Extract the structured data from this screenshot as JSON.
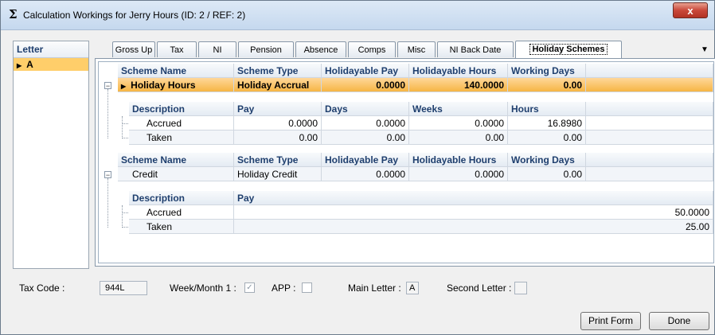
{
  "window": {
    "title": "Calculation Workings for Jerry Hours (ID: 2  /  REF: 2)",
    "title_icon": "Σ",
    "close_glyph": "x"
  },
  "letters": {
    "header": "Letter",
    "rows": [
      {
        "label": "A"
      }
    ]
  },
  "tabs": [
    {
      "label": "Gross Up"
    },
    {
      "label": "Tax"
    },
    {
      "label": "NI"
    },
    {
      "label": "Pension"
    },
    {
      "label": "Absence"
    },
    {
      "label": "Comps"
    },
    {
      "label": "Misc"
    },
    {
      "label": "NI Back Date"
    },
    {
      "label": "Holiday Schemes",
      "active": true
    }
  ],
  "scheme_headers": {
    "name": "Scheme Name",
    "type": "Scheme Type",
    "pay": "Holidayable Pay",
    "hours": "Holidayable Hours",
    "days": "Working Days"
  },
  "schemes": [
    {
      "name": "Holiday Hours",
      "type": "Holiday Accrual",
      "pay": "0.0000",
      "hours": "140.0000",
      "days": "0.00",
      "detail_headers": {
        "description": "Description",
        "pay": "Pay",
        "days": "Days",
        "weeks": "Weeks",
        "hours": "Hours"
      },
      "details": [
        {
          "description": "Accrued",
          "pay": "0.0000",
          "days": "0.0000",
          "weeks": "0.0000",
          "hours": "16.8980"
        },
        {
          "description": "Taken",
          "pay": "0.00",
          "days": "0.00",
          "weeks": "0.00",
          "hours": "0.00"
        }
      ]
    },
    {
      "name": "Credit",
      "type": "Holiday Credit",
      "pay": "0.0000",
      "hours": "0.0000",
      "days": "0.00",
      "detail_headers": {
        "description": "Description",
        "pay": "Pay"
      },
      "details": [
        {
          "description": "Accrued",
          "pay": "50.0000"
        },
        {
          "description": "Taken",
          "pay": "25.00"
        }
      ]
    }
  ],
  "footer": {
    "tax_code_label": "Tax Code :",
    "tax_code_value": "944L",
    "week_month_label": "Week/Month 1 :",
    "week_month_checked": true,
    "app_label": "APP :",
    "main_letter_label": "Main Letter :",
    "main_letter_value": "A",
    "second_letter_label": "Second Letter :",
    "second_letter_value": "",
    "print_button": "Print Form",
    "done_button": "Done"
  },
  "colors": {
    "selected_row": "#f6b545",
    "header_text": "#1f3f6e",
    "letter_row": "#ffce6a"
  }
}
